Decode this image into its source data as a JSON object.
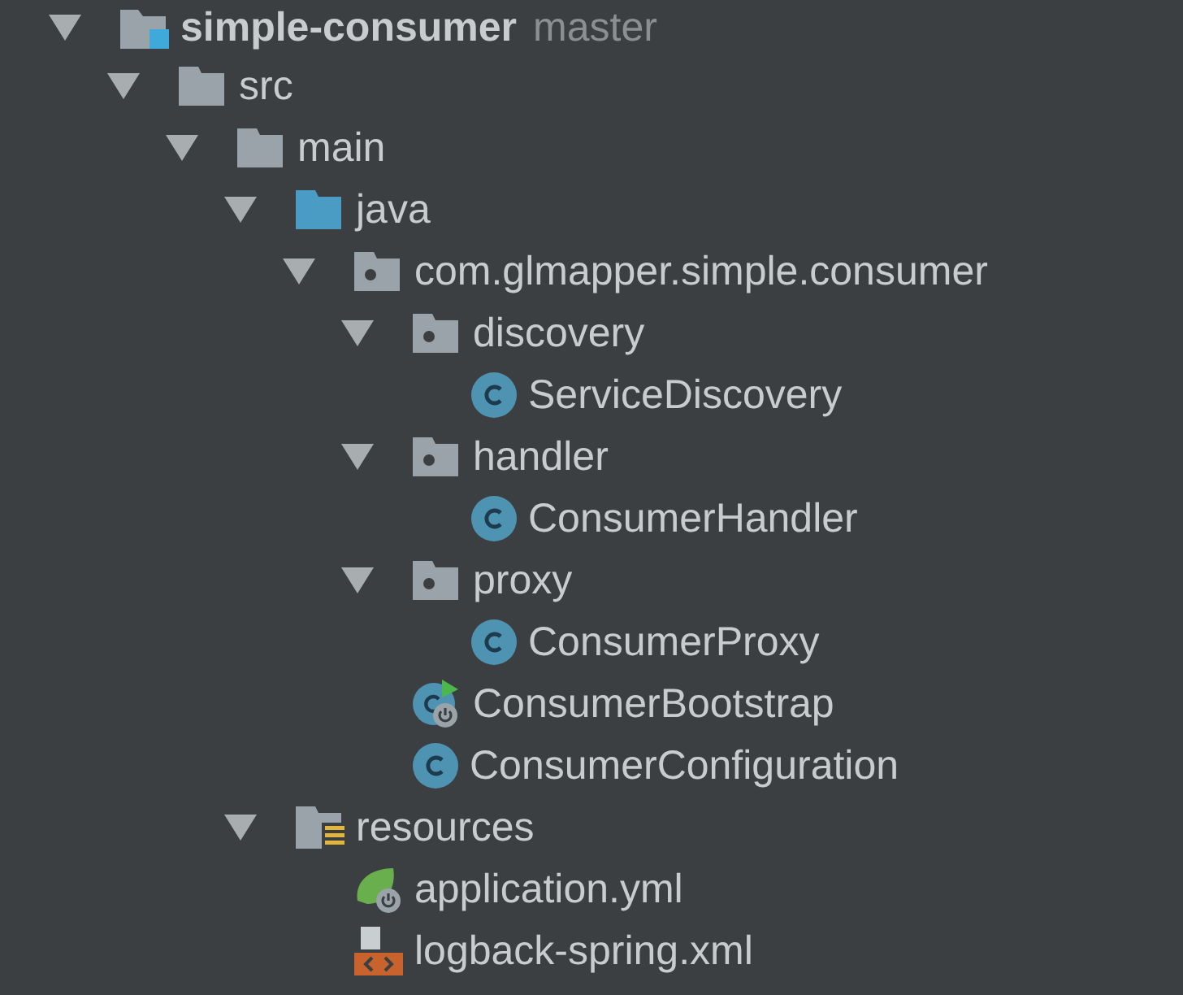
{
  "tree": [
    {
      "kind": "module",
      "label": "simple-consumer",
      "branch": "master",
      "expanded": true,
      "children": [
        {
          "kind": "folder",
          "label": "src",
          "expanded": true,
          "children": [
            {
              "kind": "folder",
              "label": "main",
              "expanded": true,
              "children": [
                {
                  "kind": "source-folder",
                  "label": "java",
                  "expanded": true,
                  "children": [
                    {
                      "kind": "package",
                      "label": "com.glmapper.simple.consumer",
                      "expanded": true,
                      "children": [
                        {
                          "kind": "package",
                          "label": "discovery",
                          "expanded": true,
                          "children": [
                            {
                              "kind": "class",
                              "label": "ServiceDiscovery"
                            }
                          ]
                        },
                        {
                          "kind": "package",
                          "label": "handler",
                          "expanded": true,
                          "children": [
                            {
                              "kind": "class",
                              "label": "ConsumerHandler"
                            }
                          ]
                        },
                        {
                          "kind": "package",
                          "label": "proxy",
                          "expanded": true,
                          "children": [
                            {
                              "kind": "class",
                              "label": "ConsumerProxy"
                            }
                          ]
                        },
                        {
                          "kind": "boot-class",
                          "label": "ConsumerBootstrap"
                        },
                        {
                          "kind": "class",
                          "label": "ConsumerConfiguration"
                        }
                      ]
                    }
                  ]
                },
                {
                  "kind": "resources-folder",
                  "label": "resources",
                  "expanded": true,
                  "children": [
                    {
                      "kind": "spring-config",
                      "label": "application.yml"
                    },
                    {
                      "kind": "xml",
                      "label": "logback-spring.xml"
                    }
                  ]
                }
              ]
            }
          ]
        }
      ]
    }
  ]
}
